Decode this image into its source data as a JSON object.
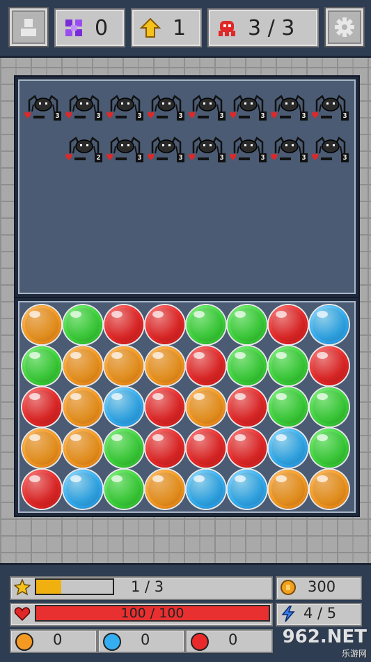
{
  "header": {
    "gems": "0",
    "upgrades": "1",
    "enemies": "3 / 3",
    "profile_icon": "profile-icon",
    "settings_icon": "gear-icon",
    "gem_color": "#7a2bd9",
    "upgrade_color": "#f4c21a",
    "enemy_color": "#e02828"
  },
  "enemies": {
    "row1": [
      "3",
      "3",
      "3",
      "3",
      "3",
      "3",
      "3",
      "3"
    ],
    "row2": [
      "2",
      "3",
      "3",
      "3",
      "3",
      "3",
      "3"
    ]
  },
  "board": {
    "rows": [
      [
        "orange",
        "green",
        "red",
        "red",
        "green",
        "green",
        "red",
        "blue"
      ],
      [
        "green",
        "orange",
        "orange",
        "orange",
        "red",
        "green",
        "green",
        "red"
      ],
      [
        "red",
        "orange",
        "blue",
        "red",
        "orange",
        "red",
        "green",
        "green"
      ],
      [
        "orange",
        "orange",
        "green",
        "red",
        "red",
        "red",
        "blue",
        "green"
      ],
      [
        "red",
        "blue",
        "green",
        "orange",
        "blue",
        "blue",
        "orange",
        "orange"
      ]
    ]
  },
  "stats": {
    "xp_text": "1 / 3",
    "xp_fraction": 0.33,
    "coins": "300",
    "hp_text": "100 / 100",
    "hp_fraction": 1.0,
    "energy": "4 / 5",
    "orange_count": "0",
    "blue_count": "0",
    "red_count": "0"
  },
  "watermark": {
    "main": "962.NET",
    "sub": "乐游网"
  }
}
